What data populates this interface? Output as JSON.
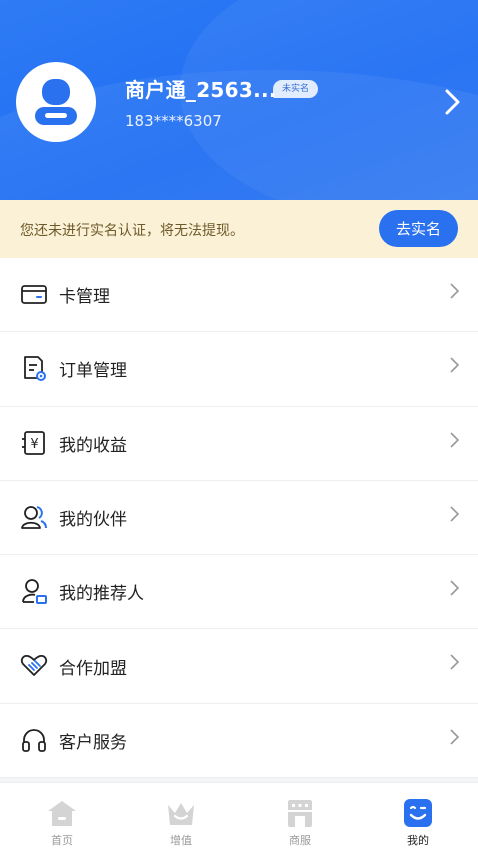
{
  "header": {
    "username": "商户通_2563...",
    "verify_badge": "未实名",
    "phone": "183****6307"
  },
  "notice": {
    "text": "您还未进行实名认证，将无法提现。",
    "button": "去实名"
  },
  "menu": {
    "items": [
      {
        "label": "卡管理",
        "icon": "card-icon"
      },
      {
        "label": "订单管理",
        "icon": "order-icon"
      },
      {
        "label": "我的收益",
        "icon": "earnings-icon"
      },
      {
        "label": "我的伙伴",
        "icon": "partners-icon"
      },
      {
        "label": "我的推荐人",
        "icon": "referrer-icon"
      },
      {
        "label": "合作加盟",
        "icon": "handshake-icon"
      },
      {
        "label": "客户服务",
        "icon": "headset-icon"
      }
    ]
  },
  "tabbar": {
    "tabs": [
      {
        "label": "首页",
        "icon": "home-icon"
      },
      {
        "label": "增值",
        "icon": "crown-icon"
      },
      {
        "label": "商服",
        "icon": "store-icon"
      },
      {
        "label": "我的",
        "icon": "profile-icon"
      }
    ],
    "active_index": 3
  },
  "colors": {
    "brand_blue": "#2a71f0",
    "notice_bg": "#fbf1d6",
    "tab_inactive": "#d6d6d6"
  }
}
